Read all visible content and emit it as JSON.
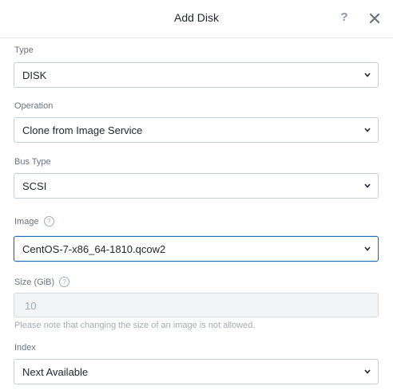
{
  "dialog": {
    "title": "Add Disk",
    "help_label": "?"
  },
  "fields": {
    "type": {
      "label": "Type",
      "value": "DISK"
    },
    "operation": {
      "label": "Operation",
      "value": "Clone from Image Service"
    },
    "bus_type": {
      "label": "Bus Type",
      "value": "SCSI"
    },
    "image": {
      "label": "Image",
      "value": "CentOS-7-x86_64-1810.qcow2"
    },
    "size": {
      "label": "Size (GiB)",
      "value": "10",
      "hint": "Please note that changing the size of an image is not allowed."
    },
    "index": {
      "label": "Index",
      "value": "Next Available"
    }
  },
  "icons": {
    "info": "?",
    "close": "close-icon",
    "chevron": "chevron-down-icon"
  },
  "colors": {
    "focus_border": "#1b6dc6",
    "muted_text": "#a3acb7",
    "label_text": "#6a7380"
  }
}
